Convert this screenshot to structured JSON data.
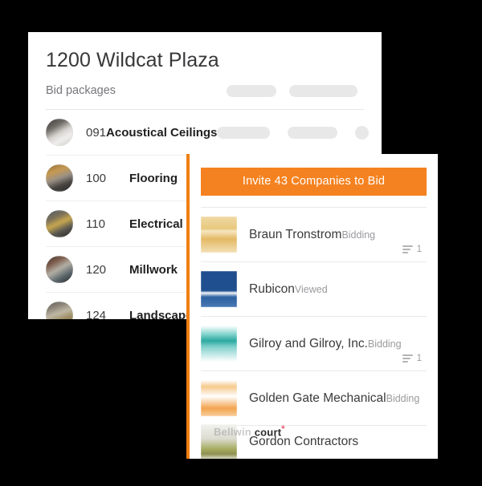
{
  "packages_panel": {
    "title": "1200 Wildcat Plaza",
    "subtitle": "Bid packages",
    "rows": [
      {
        "number": "091",
        "name": "Acoustical Ceilings",
        "avatar_icon": "person-photo-avatar"
      },
      {
        "number": "100",
        "name": "Flooring",
        "avatar_icon": "person-photo-avatar"
      },
      {
        "number": "110",
        "name": "Electrical",
        "avatar_icon": "person-photo-avatar"
      },
      {
        "number": "120",
        "name": "Millwork",
        "avatar_icon": "person-photo-avatar"
      },
      {
        "number": "124",
        "name": "Landscape",
        "avatar_icon": "person-photo-avatar"
      }
    ]
  },
  "companies_panel": {
    "invite_button_label": "Invite 43 Companies to Bid",
    "accent_color": "#F58220",
    "border_color": "#F07F13",
    "rows": [
      {
        "name": "Braun Tronstrom",
        "status": "Bidding",
        "count": "1",
        "logo_icon": "braun-tronstrom-logo"
      },
      {
        "name": "Rubicon",
        "status": "Viewed",
        "count": "",
        "logo_icon": "rubicon-logo"
      },
      {
        "name": "Gilroy and Gilroy, Inc.",
        "status": "Bidding",
        "count": "1",
        "logo_icon": "gilroy-and-gilroy-logo"
      },
      {
        "name": "Golden Gate Mechanical",
        "status": "Bidding",
        "count": "",
        "logo_icon": "golden-gate-mechanical-logo"
      },
      {
        "name": "Gordon Contractors",
        "status": "",
        "count": "",
        "logo_icon": "gordon-contractors-logo"
      }
    ],
    "watermark": {
      "faded_text": "Bellwin",
      "text": "court",
      "star": "*"
    }
  }
}
